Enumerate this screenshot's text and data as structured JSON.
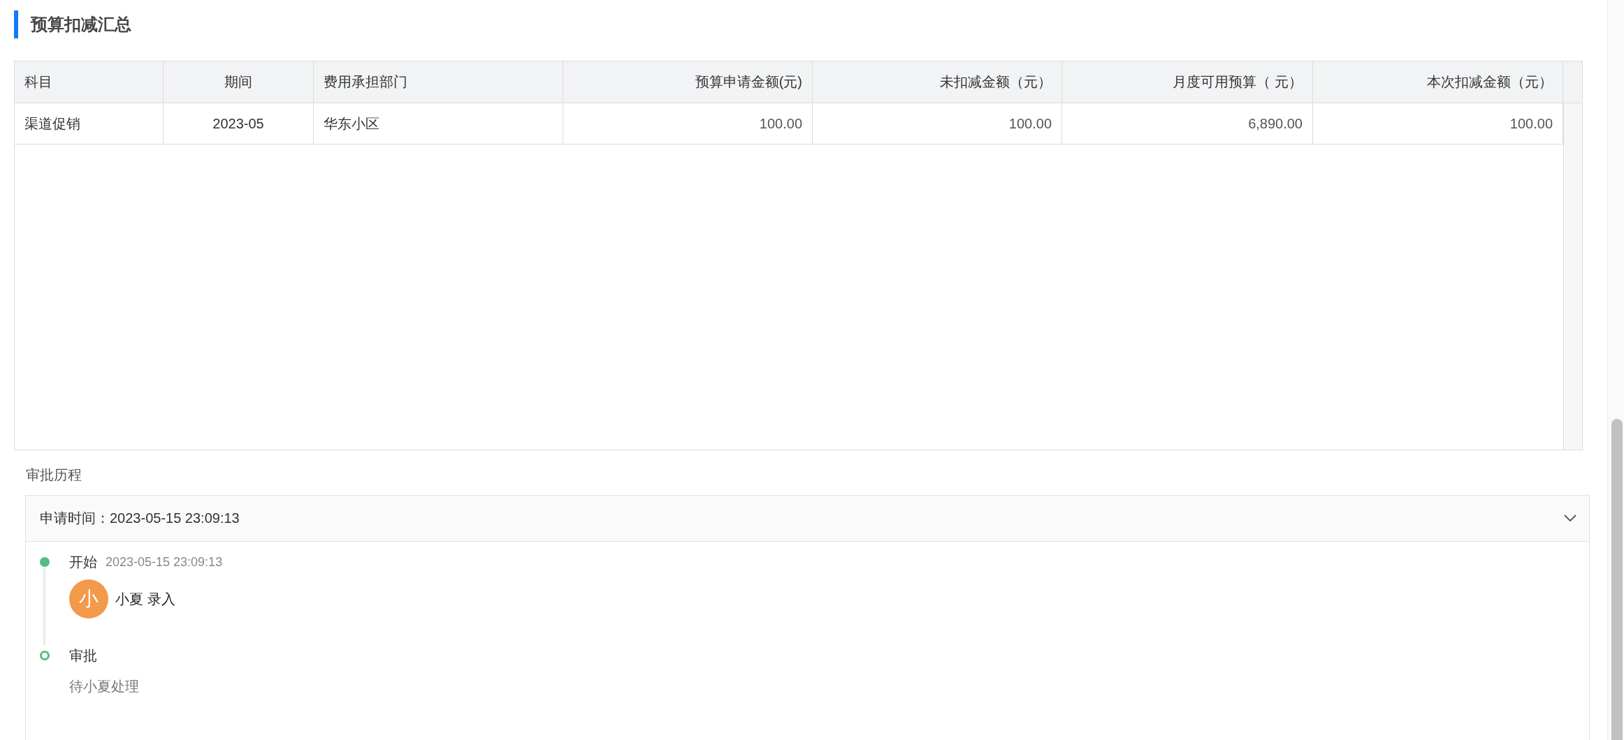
{
  "section": {
    "title": "预算扣减汇总"
  },
  "table": {
    "columns": [
      {
        "label": "科目",
        "kind": "text"
      },
      {
        "label": "期间",
        "kind": "period"
      },
      {
        "label": "费用承担部门",
        "kind": "text"
      },
      {
        "label": "预算申请金额(元)",
        "kind": "amount"
      },
      {
        "label": "未扣减金额（元）",
        "kind": "amount"
      },
      {
        "label": "月度可用预算（ 元）",
        "kind": "amount"
      },
      {
        "label": "本次扣减金额（元）",
        "kind": "amount"
      }
    ],
    "rows": [
      [
        "渠道促销",
        "2023-05",
        "华东小区",
        "100.00",
        "100.00",
        "6,890.00",
        "100.00"
      ]
    ]
  },
  "approval": {
    "title": "审批历程",
    "apply_time": "申请时间：2023-05-15 23:09:13",
    "expanded": true,
    "steps": [
      {
        "name": "开始",
        "time": "2023-05-15 23:09:13",
        "done": true,
        "avatar": "小",
        "person_action": "小夏 录入"
      },
      {
        "name": "审批",
        "done": false,
        "note": "待小夏处理"
      }
    ]
  }
}
